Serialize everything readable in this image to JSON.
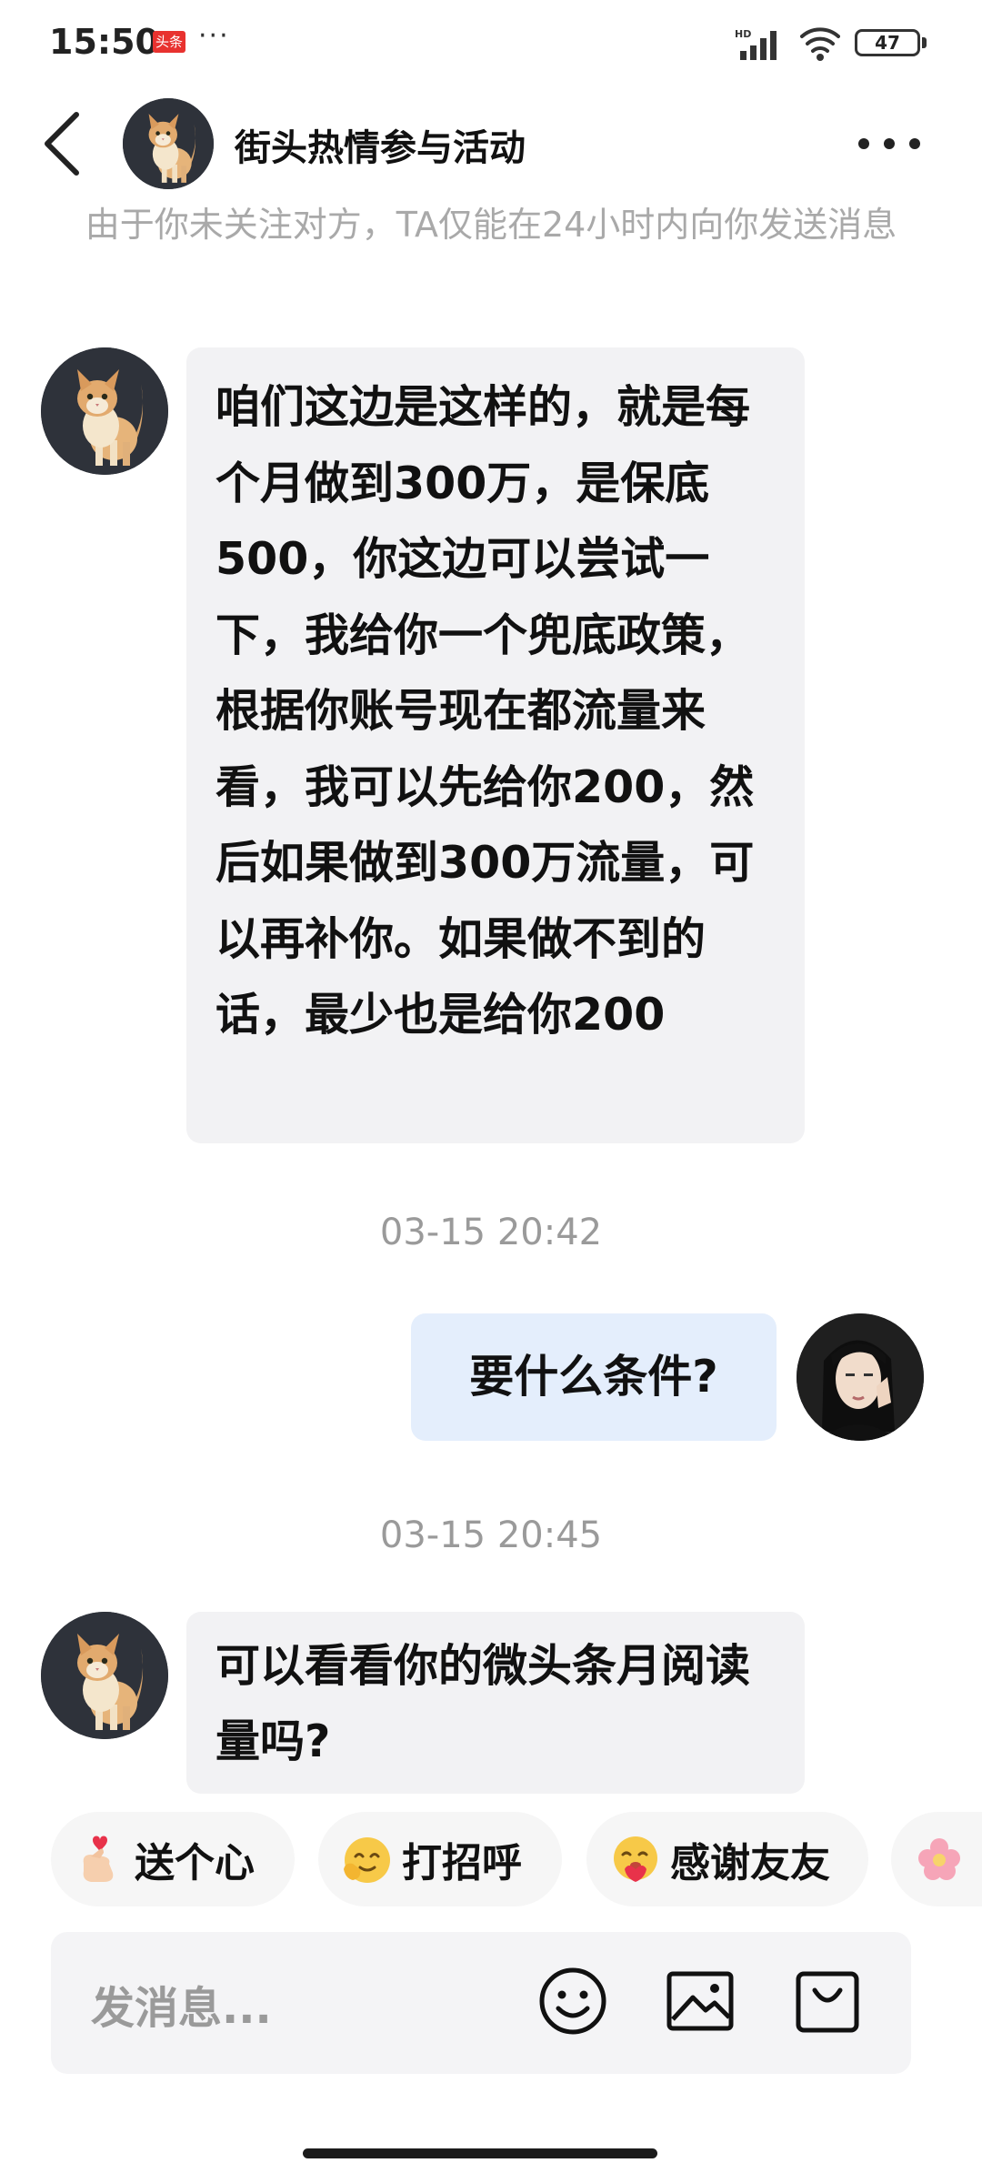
{
  "status_bar": {
    "time": "15:50",
    "app_badge": "头条",
    "more_dots": "···",
    "network": "HD",
    "battery": "47"
  },
  "header": {
    "title": "街头热情参与活动"
  },
  "notice": "由于你未关注对方，TA仅能在24小时内向你发送消息",
  "messages": [
    {
      "side": "incoming",
      "text": "咱们这边是这样的，就是每个月做到300万，是保底500，你这边可以尝试一下，我给你一个兜底政策，根据你账号现在都流量来看，我可以先给你200，然后如果做到300万流量，可以再补你。如果做不到的话，最少也是给你200"
    },
    {
      "side": "time",
      "text": "03-15 20:42"
    },
    {
      "side": "outgoing",
      "text": "要什么条件?"
    },
    {
      "side": "time",
      "text": "03-15 20:45"
    },
    {
      "side": "incoming",
      "text": "可以看看你的微头条月阅读量吗?"
    }
  ],
  "quick_replies": [
    {
      "label": "送个心",
      "icon": "finger-heart-icon"
    },
    {
      "label": "打招呼",
      "icon": "smiling-face-icon"
    },
    {
      "label": "感谢友友",
      "icon": "hugging-face-icon"
    },
    {
      "label": "",
      "icon": "flower-icon"
    }
  ],
  "composer": {
    "placeholder": "发消息..."
  },
  "colors": {
    "incoming_bubble": "#f2f2f4",
    "outgoing_bubble": "#e4eefc",
    "badge_red": "#e8322f"
  }
}
